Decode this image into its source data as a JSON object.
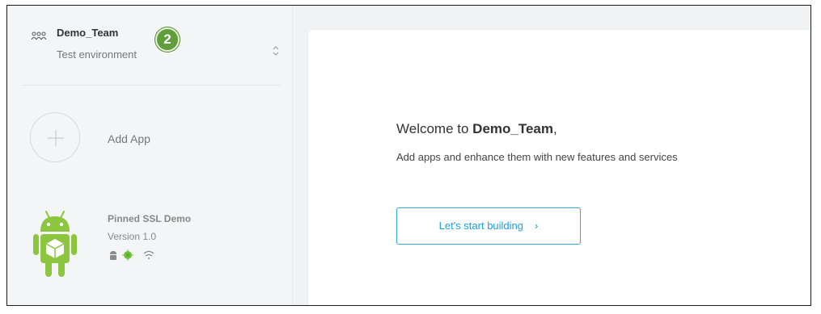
{
  "team": {
    "name": "Demo_Team",
    "environment": "Test environment",
    "step_badge": "2"
  },
  "sidebar": {
    "add_app_label": "Add App",
    "apps": [
      {
        "name": "Pinned SSL Demo",
        "version": "Version 1.0",
        "icon": "android-robot-icon",
        "platform_icons": [
          "android-icon",
          "android-sdk-icon",
          "wifi-icon"
        ]
      }
    ]
  },
  "main": {
    "welcome_prefix": "Welcome to ",
    "welcome_team": "Demo_Team",
    "welcome_suffix": ",",
    "subtitle": "Add apps and enhance them with new features and services",
    "cta_label": "Let's start building",
    "cta_arrow": "›"
  },
  "colors": {
    "accent": "#1fa0dc",
    "badge": "#5f9e3a",
    "android_green": "#8cc63f"
  }
}
